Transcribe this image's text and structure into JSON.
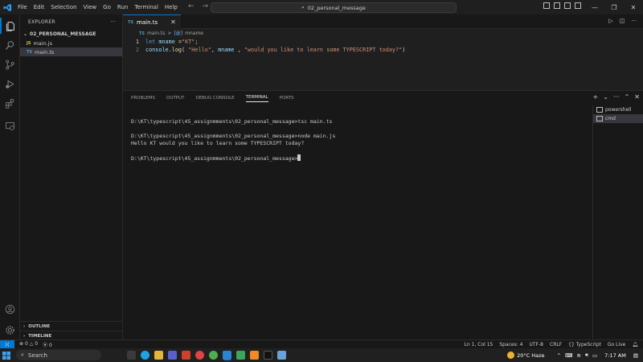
{
  "titlebar": {
    "menu": [
      "File",
      "Edit",
      "Selection",
      "View",
      "Go",
      "Run",
      "Terminal",
      "Help"
    ],
    "command_center": "02_personal_message"
  },
  "sidebar": {
    "header": "EXPLORER",
    "more": "···",
    "folder": "02_PERSONAL_MESSAGE",
    "files": [
      {
        "name": "main.js",
        "icon_label": "JS"
      },
      {
        "name": "main.ts",
        "icon_label": "TS"
      }
    ],
    "outline": "OUTLINE",
    "timeline": "TIMELINE"
  },
  "editor": {
    "tab": {
      "label": "main.ts",
      "icon_label": "TS"
    },
    "breadcrumb": {
      "file": "main.ts",
      "separator": ">",
      "symbol": "mname",
      "symbol_icon": "[@]",
      "file_icon_label": "TS"
    },
    "lines": [
      {
        "num": "1",
        "p1": "let",
        "p2": " mname ",
        "p3": "=",
        "p4": "\"KT\"",
        "p5": ";"
      },
      {
        "num": "2",
        "p1": "console",
        "p2": ".",
        "p3": "log",
        "p4": "( ",
        "p5": "\"Hello\"",
        "p6": ", ",
        "p7": "mname",
        "p8": " , ",
        "p9": "\"would you like to learn some TYPESCRIPT today?\"",
        "p10": ")"
      }
    ]
  },
  "panel": {
    "tabs": [
      "PROBLEMS",
      "OUTPUT",
      "DEBUG CONSOLE",
      "TERMINAL",
      "PORTS"
    ],
    "active_tab": "TERMINAL",
    "terminal_lines": [
      "D:\\KT\\typescript\\45_assignmments\\02_personal_message>tsc main.ts",
      "",
      "D:\\KT\\typescript\\45_assignmments\\02_personal_message>node main.js",
      "Hello KT would you like to learn some TYPESCRIPT today?",
      "",
      "D:\\KT\\typescript\\45_assignmments\\02_personal_message>"
    ],
    "terminals": [
      "powershell",
      "cmd"
    ]
  },
  "statusbar": {
    "errors": "0",
    "warnings": "0",
    "ports": "0",
    "right": [
      "Ln 1, Col 15",
      "Spaces: 4",
      "UTF-8",
      "CRLF",
      "{} TypeScript",
      "Go Live"
    ]
  },
  "taskbar": {
    "search": "Search",
    "weather": "20°C  Haze",
    "time": "7:17 AM"
  },
  "colors": {
    "accent": "#0078d4",
    "editor_bg": "#1f1f1f",
    "sidebar_bg": "#181818"
  }
}
